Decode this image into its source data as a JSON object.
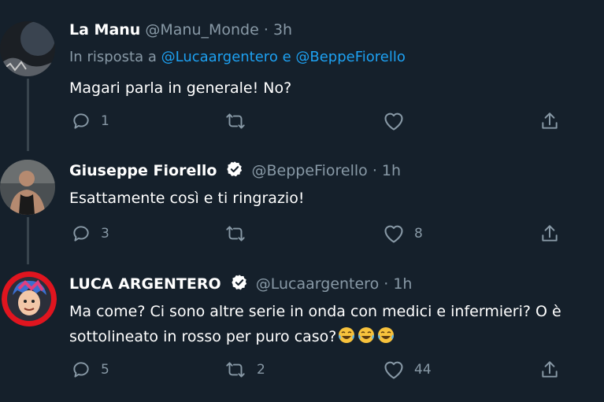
{
  "tweets": [
    {
      "name": "La Manu",
      "handle": "@Manu_Monde",
      "dot": "·",
      "time": "3h",
      "reply_prefix": "In risposta a",
      "reply_mention_1": "@Lucaargentero",
      "reply_and": "e",
      "reply_mention_2": "@BeppeFiorello",
      "text": "Magari parla in generale! No?",
      "replies": "1",
      "retweets": "",
      "likes": ""
    },
    {
      "name": "Giuseppe Fiorello",
      "handle": "@BeppeFiorello",
      "dot": "·",
      "time": "1h",
      "text": "Esattamente così e ti ringrazio!",
      "replies": "3",
      "retweets": "",
      "likes": "8"
    },
    {
      "name": "LUCA ARGENTERO",
      "handle": "@Lucaargentero",
      "dot": "·",
      "time": "1h",
      "text_line1": "Ma come? Ci sono altre serie in onda con medici e infermieri? O è",
      "text_line2": "sottolineato in rosso per puro caso?",
      "emoji_name": "face-with-tears-of-joy",
      "replies": "5",
      "retweets": "2",
      "likes": "44"
    }
  ],
  "colors": {
    "background": "#15202b",
    "secondary_text": "#8899a6",
    "mention": "#1da1f2",
    "thread_line": "#38444d"
  }
}
